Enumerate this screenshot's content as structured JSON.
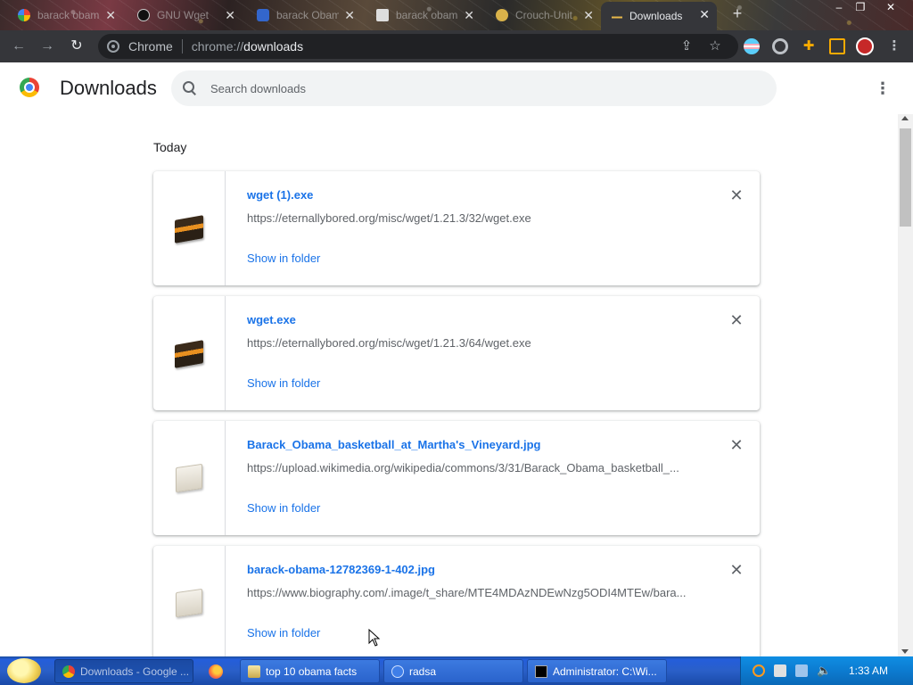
{
  "tabs": [
    {
      "title": "barack obama",
      "favicon": "google-icon",
      "active": false
    },
    {
      "title": "GNU Wget",
      "favicon": "gnu-icon",
      "active": false
    },
    {
      "title": "barack Obama",
      "favicon": "wiki-icon",
      "active": false
    },
    {
      "title": "barack obama",
      "favicon": "bing-icon",
      "active": false
    },
    {
      "title": "Crouch-Unit",
      "favicon": "yellow-icon",
      "active": false
    },
    {
      "title": "Downloads",
      "favicon": "download-icon",
      "active": true
    }
  ],
  "toolbar": {
    "site_label": "Chrome",
    "url_scheme": "chrome://",
    "url_host": "downloads"
  },
  "header": {
    "title": "Downloads",
    "search_placeholder": "Search downloads"
  },
  "downloads": {
    "date_heading": "Today",
    "show_in_folder_label": "Show in folder",
    "items": [
      {
        "name": "wget (1).exe",
        "url": "https://eternallybored.org/misc/wget/1.21.3/32/wget.exe",
        "type": "exe"
      },
      {
        "name": "wget.exe",
        "url": "https://eternallybored.org/misc/wget/1.21.3/64/wget.exe",
        "type": "exe"
      },
      {
        "name": "Barack_Obama_basketball_at_Martha's_Vineyard.jpg",
        "url": "https://upload.wikimedia.org/wikipedia/commons/3/31/Barack_Obama_basketball_...",
        "type": "image"
      },
      {
        "name": "barack-obama-12782369-1-402.jpg",
        "url": "https://www.biography.com/.image/t_share/MTE4MDAzNDEwNzg5ODI4MTEw/bara...",
        "type": "image"
      }
    ]
  },
  "taskbar": {
    "tasks": [
      {
        "label": "Downloads - Google ...",
        "active": true
      },
      {
        "label": "top 10 obama facts",
        "active": false
      },
      {
        "label": "radsa",
        "active": false
      },
      {
        "label": "Administrator: C:\\Wi...",
        "active": false
      }
    ],
    "clock": "1:33 AM"
  },
  "colors": {
    "link": "#1a73e8",
    "toolbar_bg": "#35363a",
    "omnibox_bg": "#202124",
    "taskbar_blue": "#245edb"
  }
}
